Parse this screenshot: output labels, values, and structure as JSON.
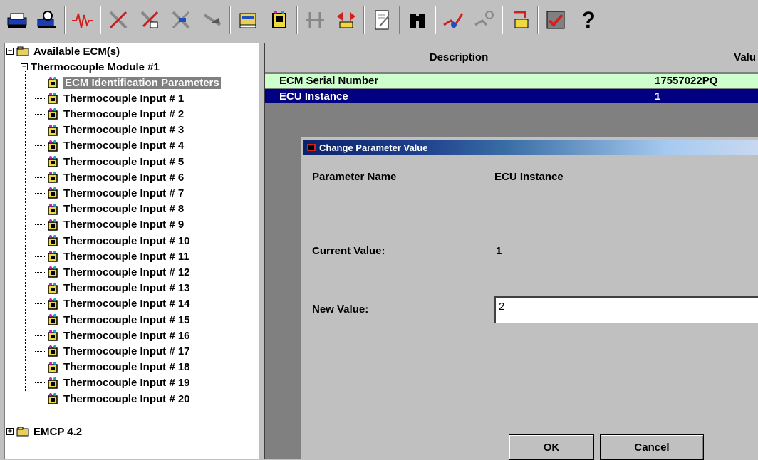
{
  "toolbar": {
    "buttons": [
      "print-icon",
      "print-preview-icon",
      "waveform-icon",
      "tools-cross-1-icon",
      "tools-cross-2-icon",
      "tools-cross-3-icon",
      "tools-cross-4-icon",
      "ecm-book-icon",
      "ecm-chip-icon",
      "data-transfer-1-icon",
      "data-transfer-2-icon",
      "edit-document-icon",
      "binoculars-icon",
      "graph-red-icon",
      "graph-gray-icon",
      "ecm-arrow-icon",
      "ecm-check-icon"
    ],
    "help_label": "?"
  },
  "tree": {
    "root_expander": "−",
    "root": "Available ECM(s)",
    "module": "Thermocouple Module #1",
    "module_expander": "−",
    "items": [
      "ECM Identification Parameters",
      "Thermocouple Input # 1",
      "Thermocouple Input # 2",
      "Thermocouple Input # 3",
      "Thermocouple Input # 4",
      "Thermocouple Input # 5",
      "Thermocouple Input # 6",
      "Thermocouple Input # 7",
      "Thermocouple Input # 8",
      "Thermocouple Input # 9",
      "Thermocouple Input # 10",
      "Thermocouple Input # 11",
      "Thermocouple Input # 12",
      "Thermocouple Input # 13",
      "Thermocouple Input # 14",
      "Thermocouple Input # 15",
      "Thermocouple Input # 16",
      "Thermocouple Input # 17",
      "Thermocouple Input # 18",
      "Thermocouple Input # 19",
      "Thermocouple Input # 20"
    ],
    "collapsed_item": "EMCP 4.2",
    "collapsed_expander": "+"
  },
  "grid": {
    "columns": [
      "Description",
      "Valu"
    ],
    "rows": [
      {
        "description": "ECM Serial Number",
        "value": "17557022PQ"
      },
      {
        "description": "ECU Instance",
        "value": "1"
      }
    ]
  },
  "dialog": {
    "title": "Change Parameter Value",
    "param_name_label": "Parameter Name",
    "param_name_value": "ECU Instance",
    "current_label": "Current Value:",
    "current_value": "1",
    "new_label": "New Value:",
    "new_value": "2",
    "ok_label": "OK",
    "cancel_label": "Cancel"
  },
  "colors": {
    "selected_row_bg": "#000080",
    "highlight_row_bg": "#ccffcc",
    "dialog_title": "#0a246a"
  }
}
